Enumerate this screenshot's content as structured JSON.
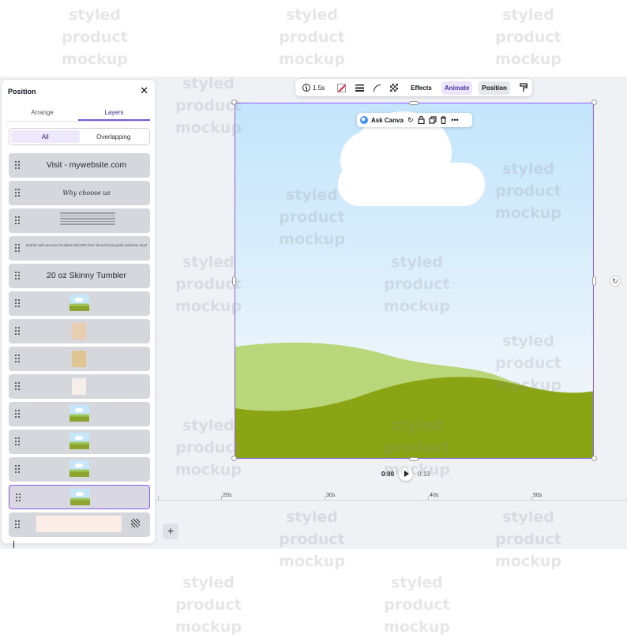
{
  "panel": {
    "title": "Position",
    "tabs": [
      {
        "label": "Arrange"
      },
      {
        "label": "Layers"
      }
    ],
    "filters": [
      {
        "label": "All"
      },
      {
        "label": "Overlapping"
      }
    ],
    "layers": [
      {
        "label": "Visit - mywebsite.com"
      },
      {
        "label": "Why choose us"
      },
      {
        "label": ""
      },
      {
        "label": "double wall vacuum insulated with BPA free lid and food grade stainless steel"
      },
      {
        "label": "20 oz Skinny Tumbler"
      }
    ]
  },
  "toolbar": {
    "duration": "1.5s",
    "effects": "Effects",
    "animate": "Animate",
    "position": "Position"
  },
  "context": {
    "ask": "Ask Canva"
  },
  "playback": {
    "current": "0:00",
    "total": "0:13"
  },
  "timeline": {
    "ticks": [
      "20s",
      "30s",
      "40s",
      "50s"
    ]
  },
  "watermark": "styled\nproduct\nmockup",
  "colors": {
    "accent": "#8b5cf6",
    "hill_light": "#b9d67a",
    "hill_dark": "#8aa413",
    "sky": "#c3e5fb"
  },
  "icons": [
    "timer-icon",
    "no-fill-icon",
    "border-style-icon",
    "corner-rounding-icon",
    "transparency-icon",
    "paint-roller-icon",
    "ai-icon",
    "refresh-icon",
    "lock-icon",
    "duplicate-icon",
    "trash-icon",
    "more-icon",
    "rotate-icon",
    "play-icon",
    "plus-icon",
    "close-icon",
    "drag-handle-icon"
  ]
}
